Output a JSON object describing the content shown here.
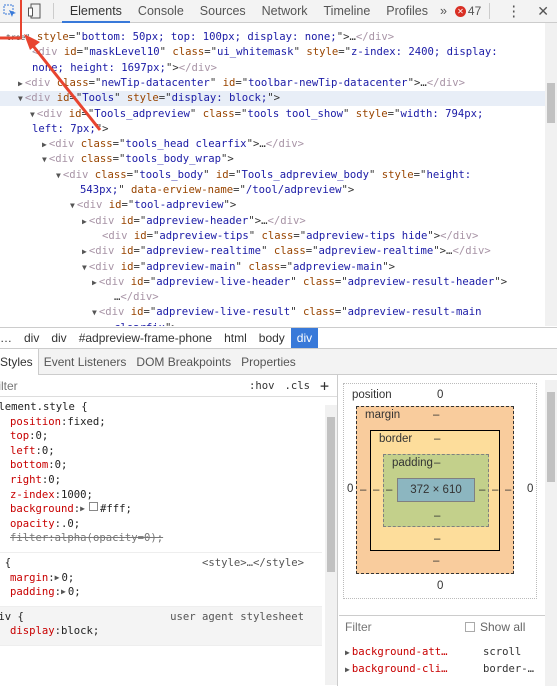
{
  "toolbar": {
    "tabs": [
      "Elements",
      "Console",
      "Sources",
      "Network",
      "Timeline",
      "Profiles"
    ],
    "active_tab": "Elements",
    "more": "»",
    "error_count": "47",
    "menu": "⋮",
    "close": "✕"
  },
  "tree": [
    {
      "pre": "tree\" ",
      "parts": [
        [
          "an",
          "style"
        ],
        [
          "tx",
          "=\""
        ],
        [
          "av",
          "bottom: 50px; top: 100px; display: none;"
        ],
        [
          "tx",
          "\">…"
        ],
        [
          "tag",
          "</div>"
        ]
      ]
    },
    {
      "pre": "",
      "parts": [
        [
          "tag",
          "<div "
        ],
        [
          "an",
          "id"
        ],
        [
          "tx",
          "=\""
        ],
        [
          "av",
          "maskLevel10"
        ],
        [
          "tx",
          "\" "
        ],
        [
          "an",
          "class"
        ],
        [
          "tx",
          "=\""
        ],
        [
          "av",
          "ui_whitemask"
        ],
        [
          "tx",
          "\" "
        ],
        [
          "an",
          "style"
        ],
        [
          "tx",
          "=\""
        ],
        [
          "av",
          "z-index: 2400; display:"
        ]
      ]
    },
    {
      "pre": "",
      "parts": [
        [
          "av",
          "none; height: 1697px;"
        ],
        [
          "tx",
          "\">"
        ],
        [
          "tag",
          "</div>"
        ]
      ]
    },
    {
      "pre": "▶",
      "parts": [
        [
          "tag",
          "<div "
        ],
        [
          "an",
          "class"
        ],
        [
          "tx",
          "=\""
        ],
        [
          "av",
          "newTip-datacenter"
        ],
        [
          "tx",
          "\" "
        ],
        [
          "an",
          "id"
        ],
        [
          "tx",
          "=\""
        ],
        [
          "av",
          "toolbar-newTip-datacenter"
        ],
        [
          "tx",
          "\">…"
        ],
        [
          "tag",
          "</div>"
        ]
      ]
    },
    {
      "pre": "▼",
      "parts": [
        [
          "tag",
          "<div "
        ],
        [
          "an",
          "id"
        ],
        [
          "tx",
          "=\""
        ],
        [
          "av",
          "Tools"
        ],
        [
          "tx",
          "\" "
        ],
        [
          "an",
          "style"
        ],
        [
          "tx",
          "=\""
        ],
        [
          "av",
          "display: block;"
        ],
        [
          "tx",
          "\">"
        ]
      ]
    },
    {
      "pre": "▼",
      "parts": [
        [
          "tag",
          "<div "
        ],
        [
          "an",
          "id"
        ],
        [
          "tx",
          "=\""
        ],
        [
          "av",
          "Tools_adpreview"
        ],
        [
          "tx",
          "\" "
        ],
        [
          "an",
          "class"
        ],
        [
          "tx",
          "=\""
        ],
        [
          "av",
          "tools tool_show"
        ],
        [
          "tx",
          "\" "
        ],
        [
          "an",
          "style"
        ],
        [
          "tx",
          "=\""
        ],
        [
          "av",
          "width: 794px;"
        ]
      ]
    },
    {
      "pre": "",
      "parts": [
        [
          "av",
          "left: 7px;"
        ],
        [
          "tx",
          "\">"
        ]
      ]
    },
    {
      "pre": "▶",
      "parts": [
        [
          "tag",
          "<div "
        ],
        [
          "an",
          "class"
        ],
        [
          "tx",
          "=\""
        ],
        [
          "av",
          "tools_head clearfix"
        ],
        [
          "tx",
          "\">…"
        ],
        [
          "tag",
          "</div>"
        ]
      ]
    },
    {
      "pre": "▼",
      "parts": [
        [
          "tag",
          "<div "
        ],
        [
          "an",
          "class"
        ],
        [
          "tx",
          "=\""
        ],
        [
          "av",
          "tools_body_wrap"
        ],
        [
          "tx",
          "\">"
        ]
      ]
    },
    {
      "pre": "▼",
      "parts": [
        [
          "tag",
          "<div "
        ],
        [
          "an",
          "class"
        ],
        [
          "tx",
          "=\""
        ],
        [
          "av",
          "tools_body"
        ],
        [
          "tx",
          "\" "
        ],
        [
          "an",
          "id"
        ],
        [
          "tx",
          "=\""
        ],
        [
          "av",
          "Tools_adpreview_body"
        ],
        [
          "tx",
          "\" "
        ],
        [
          "an",
          "style"
        ],
        [
          "tx",
          "=\""
        ],
        [
          "av",
          "height:"
        ]
      ]
    },
    {
      "pre": "",
      "parts": [
        [
          "av",
          "543px;"
        ],
        [
          "tx",
          "\" "
        ],
        [
          "an",
          "data-erview-name"
        ],
        [
          "tx",
          "=\""
        ],
        [
          "av",
          "/tool/adpreview"
        ],
        [
          "tx",
          "\">"
        ]
      ]
    },
    {
      "pre": "▼",
      "parts": [
        [
          "tag",
          "<div "
        ],
        [
          "an",
          "id"
        ],
        [
          "tx",
          "=\""
        ],
        [
          "av",
          "tool-adpreview"
        ],
        [
          "tx",
          "\">"
        ]
      ]
    },
    {
      "pre": "▶",
      "parts": [
        [
          "tag",
          "<div "
        ],
        [
          "an",
          "id"
        ],
        [
          "tx",
          "=\""
        ],
        [
          "av",
          "adpreview-header"
        ],
        [
          "tx",
          "\">…"
        ],
        [
          "tag",
          "</div>"
        ]
      ]
    },
    {
      "pre": "",
      "parts": [
        [
          "tag",
          "<div "
        ],
        [
          "an",
          "id"
        ],
        [
          "tx",
          "=\""
        ],
        [
          "av",
          "adpreview-tips"
        ],
        [
          "tx",
          "\" "
        ],
        [
          "an",
          "class"
        ],
        [
          "tx",
          "=\""
        ],
        [
          "av",
          "adpreview-tips hide"
        ],
        [
          "tx",
          "\">"
        ],
        [
          "tag",
          "</div>"
        ]
      ]
    },
    {
      "pre": "▶",
      "parts": [
        [
          "tag",
          "<div "
        ],
        [
          "an",
          "id"
        ],
        [
          "tx",
          "=\""
        ],
        [
          "av",
          "adpreview-realtime"
        ],
        [
          "tx",
          "\" "
        ],
        [
          "an",
          "class"
        ],
        [
          "tx",
          "=\""
        ],
        [
          "av",
          "adpreview-realtime"
        ],
        [
          "tx",
          "\">…"
        ],
        [
          "tag",
          "</div>"
        ]
      ]
    },
    {
      "pre": "▼",
      "parts": [
        [
          "tag",
          "<div "
        ],
        [
          "an",
          "id"
        ],
        [
          "tx",
          "=\""
        ],
        [
          "av",
          "adpreview-main"
        ],
        [
          "tx",
          "\" "
        ],
        [
          "an",
          "class"
        ],
        [
          "tx",
          "=\""
        ],
        [
          "av",
          "adpreview-main"
        ],
        [
          "tx",
          "\">"
        ]
      ]
    },
    {
      "pre": "▶",
      "parts": [
        [
          "tag",
          "<div "
        ],
        [
          "an",
          "id"
        ],
        [
          "tx",
          "=\""
        ],
        [
          "av",
          "adpreview-live-header"
        ],
        [
          "tx",
          "\" "
        ],
        [
          "an",
          "class"
        ],
        [
          "tx",
          "=\""
        ],
        [
          "av",
          "adpreview-result-header"
        ],
        [
          "tx",
          "\">"
        ]
      ]
    },
    {
      "pre": "",
      "parts": [
        [
          "tx",
          "…"
        ],
        [
          "tag",
          "</div>"
        ]
      ]
    },
    {
      "pre": "▼",
      "parts": [
        [
          "tag",
          "<div "
        ],
        [
          "an",
          "id"
        ],
        [
          "tx",
          "=\""
        ],
        [
          "av",
          "adpreview-live-result"
        ],
        [
          "tx",
          "\" "
        ],
        [
          "an",
          "class"
        ],
        [
          "tx",
          "=\""
        ],
        [
          "av",
          "adpreview-result-main"
        ]
      ]
    },
    {
      "pre": "",
      "parts": [
        [
          "av",
          "clearfix"
        ],
        [
          "tx",
          "\">"
        ]
      ]
    }
  ],
  "breadcrumbs": [
    "…",
    "div",
    "div",
    "#adpreview-frame-phone",
    "html",
    "body",
    "div"
  ],
  "subtabs": [
    "Styles",
    "Event Listeners",
    "DOM Breakpoints",
    "Properties"
  ],
  "styles": {
    "filter_placeholder": "Filter",
    "hov": ":hov",
    "cls": ".cls",
    "add": "+",
    "rules": [
      {
        "selector": "element.style {",
        "source": "",
        "ua": false,
        "props": [
          {
            "name": "position",
            "value": "fixed;"
          },
          {
            "name": "top",
            "value": "0;"
          },
          {
            "name": "left",
            "value": "0;"
          },
          {
            "name": "bottom",
            "value": "0;"
          },
          {
            "name": "right",
            "value": "0;"
          },
          {
            "name": "z-index",
            "value": "1000;"
          },
          {
            "name": "background",
            "value": "#fff;",
            "expand": true,
            "swatch": "#ffffff"
          },
          {
            "name": "opacity",
            "value": ".0;"
          },
          {
            "name": "filter",
            "value": "alpha(opacity=0);",
            "strike": true
          }
        ]
      },
      {
        "selector": "* {",
        "source": "<style>…</style>",
        "ua": false,
        "props": [
          {
            "name": "margin",
            "value": "0;",
            "expand": true
          },
          {
            "name": "padding",
            "value": "0;",
            "expand": true
          }
        ]
      },
      {
        "selector": "div {",
        "source": "user agent stylesheet",
        "ua": true,
        "props": [
          {
            "name": "display",
            "value": "block;"
          }
        ]
      }
    ]
  },
  "box_model": {
    "position_label": "position",
    "position_top": "0",
    "position_bottom": "0",
    "position_left": "0",
    "position_right": "0",
    "margin_label": "margin",
    "margin_top": "–",
    "margin_bottom": "–",
    "margin_left": "–",
    "margin_right": "–",
    "border_label": "border",
    "border_top": "–",
    "border_bottom": "–",
    "border_left": "–",
    "border_right": "–",
    "padding_label": "padding",
    "padding_top": "–",
    "padding_bottom": "–",
    "padding_left": "–",
    "padding_right": "–",
    "content": "372 × 610",
    "colors": {
      "margin": "#f9cc9d",
      "border": "#fddd9b",
      "padding": "#c3d08b",
      "content": "#8cb6c0"
    }
  },
  "computed": {
    "filter_placeholder": "Filter",
    "show_all": "Show all",
    "rows": [
      {
        "name": "background-att…",
        "value": "scroll"
      },
      {
        "name": "background-cli…",
        "value": "border-…"
      }
    ]
  }
}
